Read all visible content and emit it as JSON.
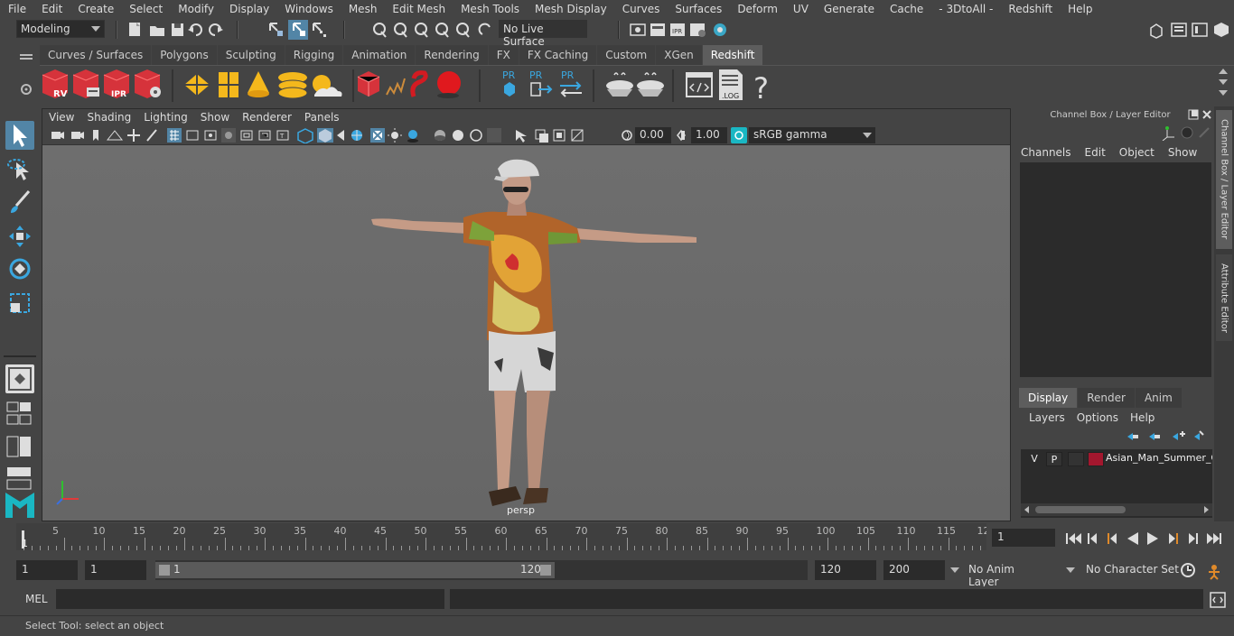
{
  "menu": [
    "File",
    "Edit",
    "Create",
    "Select",
    "Modify",
    "Display",
    "Windows",
    "Mesh",
    "Edit Mesh",
    "Mesh Tools",
    "Mesh Display",
    "Curves",
    "Surfaces",
    "Deform",
    "UV",
    "Generate",
    "Cache",
    "- 3DtoAll -",
    "Redshift",
    "Help"
  ],
  "status": {
    "mode": "Modeling",
    "live_surface": "No Live Surface"
  },
  "shelf_tabs": [
    "Curves / Surfaces",
    "Polygons",
    "Sculpting",
    "Rigging",
    "Animation",
    "Rendering",
    "FX",
    "FX Caching",
    "Custom",
    "XGen",
    "Redshift"
  ],
  "shelf_active": "Redshift",
  "shelf_icons": {
    "rv": "RV",
    "ipr": "IPR",
    "pr1": "PR",
    "pr2": "PR",
    "pr3": "PR",
    "log": ".LOG",
    "help": "?"
  },
  "viewport": {
    "menu": [
      "View",
      "Shading",
      "Lighting",
      "Show",
      "Renderer",
      "Panels"
    ],
    "exposure": "0.00",
    "gamma": "1.00",
    "color_space": "sRGB gamma",
    "camera": "persp"
  },
  "channel_box": {
    "title": "Channel Box / Layer Editor",
    "menu": [
      "Channels",
      "Edit",
      "Object",
      "Show"
    ],
    "layer_tabs": [
      "Display",
      "Render",
      "Anim"
    ],
    "layer_tab_active": "Display",
    "layer_menu": [
      "Layers",
      "Options",
      "Help"
    ],
    "layer": {
      "v": "V",
      "p": "P",
      "name": "Asian_Man_Summer_C",
      "color": "#a3172e"
    }
  },
  "side_tabs": [
    "Channel Box / Layer Editor",
    "Attribute Editor"
  ],
  "timeline": {
    "ticks": [
      "5",
      "10",
      "15",
      "20",
      "25",
      "30",
      "35",
      "40",
      "45",
      "50",
      "55",
      "60",
      "65",
      "70",
      "75",
      "80",
      "85",
      "90",
      "95",
      "100",
      "105",
      "110",
      "115",
      "12"
    ],
    "current_mark": "1",
    "current_frame": "1"
  },
  "range": {
    "start": "1",
    "playback_start": "1",
    "slider_start": "1",
    "slider_end": "120",
    "playback_end": "120",
    "end": "200",
    "anim_layer": "No Anim Layer",
    "character_set": "No Character Set"
  },
  "cmd": {
    "label": "MEL"
  },
  "help_line": "Select Tool: select an object"
}
